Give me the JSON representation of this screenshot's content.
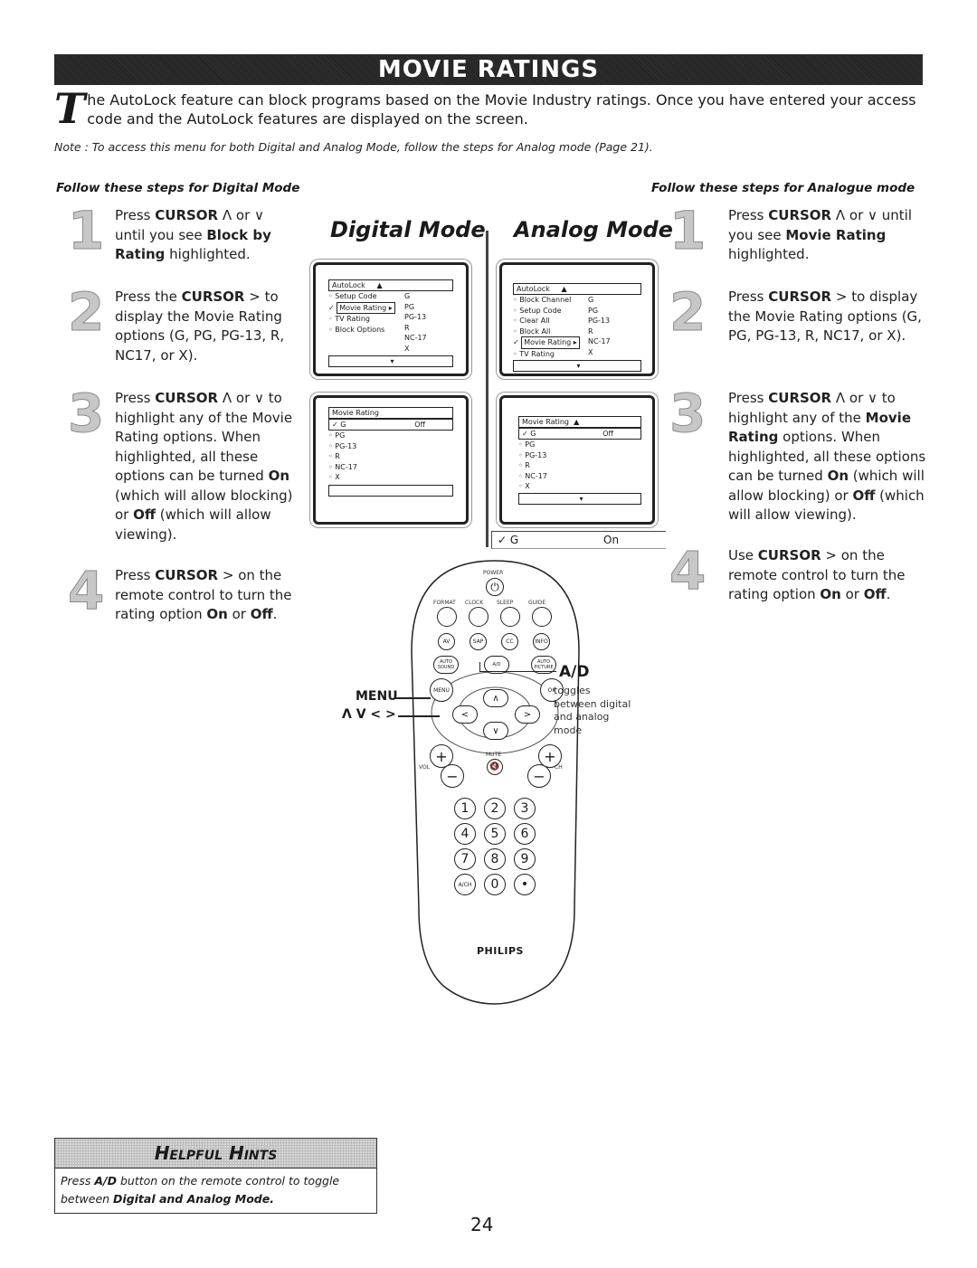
{
  "header": {
    "title": "MOVIE RATINGS"
  },
  "intro": {
    "dropcap": "T",
    "text": "he AutoLock feature can block programs based on the Movie Industry ratings.   Once you have entered your access code and the AutoLock features are displayed on the screen."
  },
  "note": "Note : To access this menu for both Digital and Analog Mode, follow the steps for Analog mode (Page 21).",
  "digital_steps": {
    "heading": "Follow these steps for Digital Mode",
    "steps": [
      {
        "num": "1",
        "parts": [
          "Press ",
          "CURSOR",
          " Λ  or ∨ until you see ",
          "Block by Rating",
          "  highlighted."
        ]
      },
      {
        "num": "2",
        "parts": [
          "Press the ",
          "CURSOR",
          "  > to display the Movie Rating options (G, PG, PG-13, R, NC17, or X).",
          "",
          ""
        ]
      },
      {
        "num": "3",
        "parts": [
          "Press ",
          "CURSOR",
          " Λ  or ∨ to highlight any of the Movie Rating options. When highlighted, all these options can be turned ",
          "On",
          " (which will allow blocking) or ",
          "Off",
          "  (which will allow viewing)."
        ]
      },
      {
        "num": "4",
        "parts": [
          "Press ",
          "CURSOR",
          " > on the remote control to turn the rating option ",
          "On",
          " or ",
          "Off",
          "."
        ]
      }
    ]
  },
  "analog_steps": {
    "heading": "Follow these steps for Analogue mode",
    "steps": [
      {
        "num": "1",
        "parts": [
          "Press ",
          "CURSOR",
          " Λ  or ∨ until you see ",
          "Movie Rating",
          " highlighted."
        ]
      },
      {
        "num": "2",
        "parts": [
          "Press ",
          "CURSOR",
          "  > to display the Movie Rating options (G, PG, PG-13, R, NC17, or X).",
          "",
          ""
        ]
      },
      {
        "num": "3",
        "parts": [
          "Press ",
          "CURSOR",
          " Λ  or ∨ to highlight any of the ",
          "Movie Rating",
          " options.  When highlighted, all these options can be turned ",
          "On",
          " (which will allow blocking) or ",
          "Off",
          " (which will allow viewing)."
        ]
      },
      {
        "num": "4",
        "parts": [
          "Use ",
          "CURSOR",
          " > on the remote control to turn the rating option ",
          "On",
          " or ",
          "Off",
          "."
        ]
      }
    ]
  },
  "digital_mode": {
    "heading": "Digital Mode",
    "screen1": {
      "menu_title": "AutoLock",
      "items": [
        "Setup Code",
        "Movie Rating",
        "TV Rating",
        "Block Options"
      ],
      "selected_index": 1,
      "values": [
        "G",
        "PG",
        "PG-13",
        "R",
        "NC-17",
        "X"
      ]
    },
    "screen2": {
      "menu_title": "Movie Rating",
      "selected": {
        "label": "G",
        "state": "Off"
      },
      "items": [
        "PG",
        "PG-13",
        "R",
        "NC-17",
        "X"
      ]
    }
  },
  "analog_mode": {
    "heading": "Analog Mode",
    "screen1": {
      "menu_title": "AutoLock",
      "items": [
        "Block Channel",
        "Setup Code",
        "Clear All",
        "Block All",
        "Movie Rating",
        "TV Rating"
      ],
      "selected_index": 4,
      "values": [
        "G",
        "PG",
        "PG-13",
        "R",
        "NC-17",
        "X"
      ]
    },
    "screen2": {
      "menu_title": "Movie Rating",
      "selected": {
        "label": "G",
        "state": "Off"
      },
      "items": [
        "PG",
        "PG-13",
        "R",
        "NC-17",
        "X"
      ]
    },
    "result_bar": {
      "label": "G",
      "state": "On"
    }
  },
  "remote": {
    "power_label": "POWER",
    "top_labels": [
      "FORMAT",
      "CLOCK",
      "SLEEP",
      "GUIDE"
    ],
    "row2": [
      "AV",
      "SAP",
      "CC",
      "INFO"
    ],
    "row3": [
      "AUTO SOUND",
      "A/D",
      "AUTO PICTURE"
    ],
    "menu": "MENU",
    "ok": "OK",
    "mute": "MUTE",
    "vol": "VOL",
    "ch": "CH",
    "numbers": [
      "1",
      "2",
      "3",
      "4",
      "5",
      "6",
      "7",
      "8",
      "9",
      "A/CH",
      "0",
      "•"
    ],
    "brand": "PHILIPS",
    "callout_ad": "A/D",
    "callout_ad_desc": "toggles between digital and analog mode",
    "callout_menu": "MENU",
    "callout_arrows": "Λ  V  <  >"
  },
  "hints": {
    "title": "Helpful Hints",
    "line1_pre": "Press ",
    "line1_bold": "A/D",
    "line1_post": " button on the remote control to toggle",
    "line2_pre": "between ",
    "line2_bold": "Digital and Analog Mode."
  },
  "page_number": "24"
}
